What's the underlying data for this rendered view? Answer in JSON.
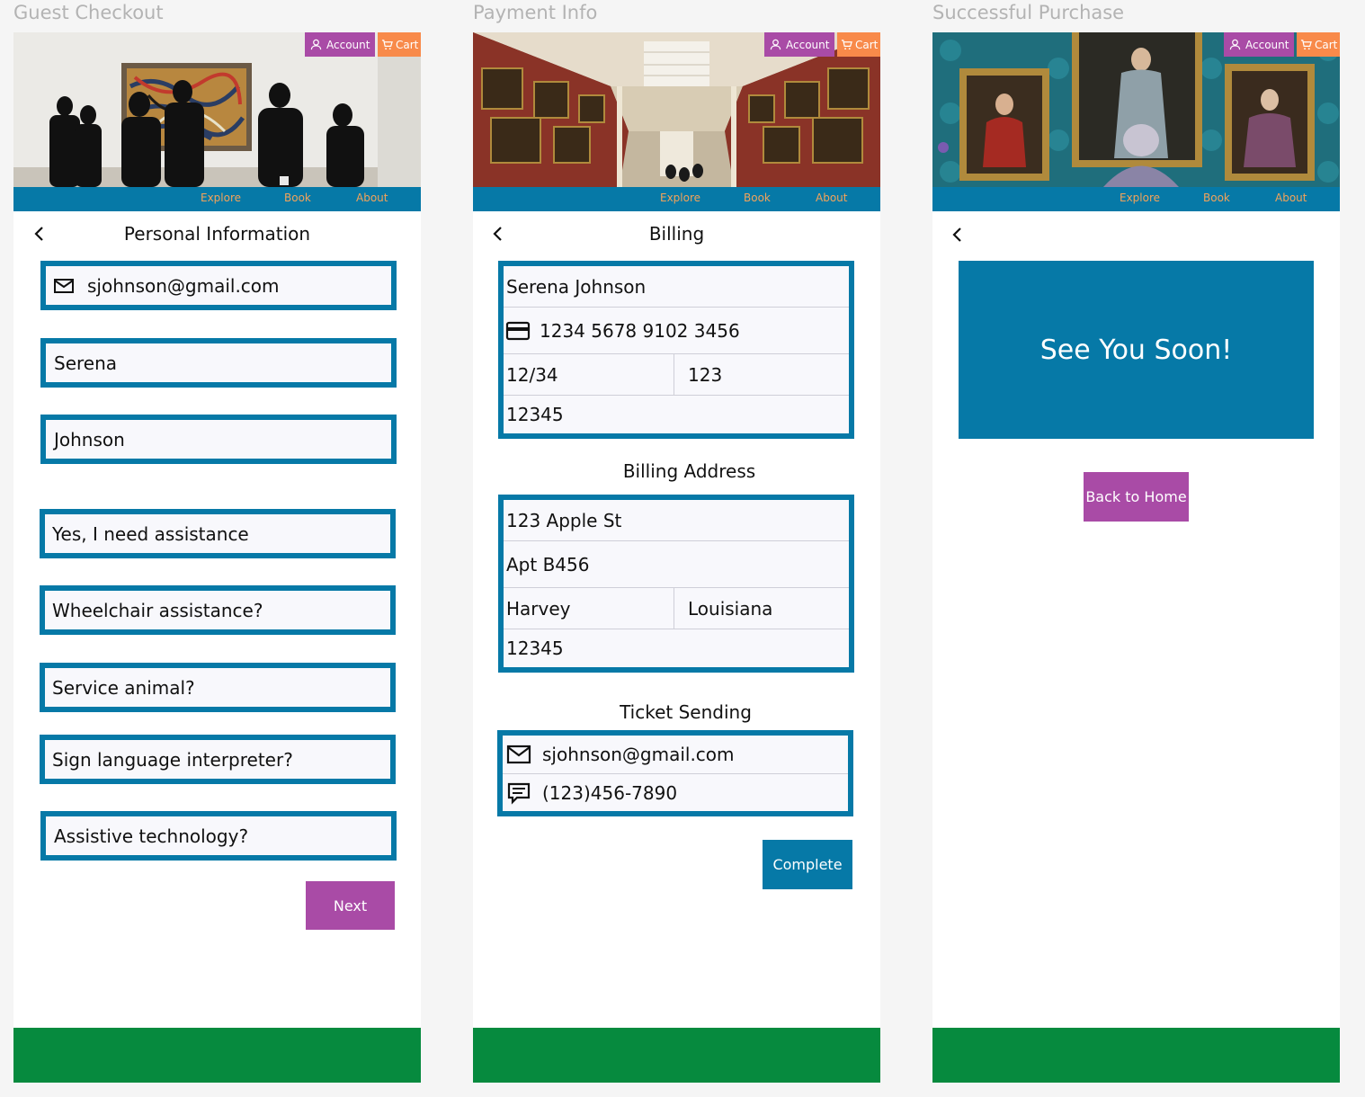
{
  "frames": [
    {
      "title": "Guest Checkout",
      "heading": "Personal Information",
      "fields": [
        {
          "value": "sjohnson@gmail.com",
          "icon": "mail-icon"
        },
        {
          "value": "Serena"
        },
        {
          "value": "Johnson"
        },
        {
          "value": "Yes, I need assistance"
        },
        {
          "value": "Wheelchair assistance?"
        },
        {
          "value": "Service animal?"
        },
        {
          "value": "Sign language interpreter?"
        },
        {
          "value": "Assistive technology?"
        }
      ],
      "button": "Next"
    },
    {
      "title": "Payment Info",
      "billing_heading": "Billing",
      "billing": {
        "name": "Serena Johnson",
        "card_number": "1234 5678 9102 3456",
        "expiry": "12/34",
        "cvv": "123",
        "zip": "12345"
      },
      "address_heading": "Billing Address",
      "address": {
        "line1": "123 Apple St",
        "line2": "Apt B456",
        "city": "Harvey",
        "state": "Louisiana",
        "zip": "12345"
      },
      "sending_heading": "Ticket Sending",
      "sending": {
        "email": "sjohnson@gmail.com",
        "phone": "(123)456-7890"
      },
      "button": "Complete"
    },
    {
      "title": "Successful Purchase",
      "banner": "See You Soon!",
      "button": "Back to Home"
    }
  ],
  "header": {
    "account_label": "Account",
    "cart_label": "Cart",
    "nav": [
      "Explore",
      "Book",
      "About"
    ]
  },
  "colors": {
    "primary_blue": "#0679a7",
    "accent_purple": "#a94ba6",
    "accent_orange": "#f88a4a",
    "footer_green": "#068a3e",
    "nav_text": "#f3a35a"
  }
}
